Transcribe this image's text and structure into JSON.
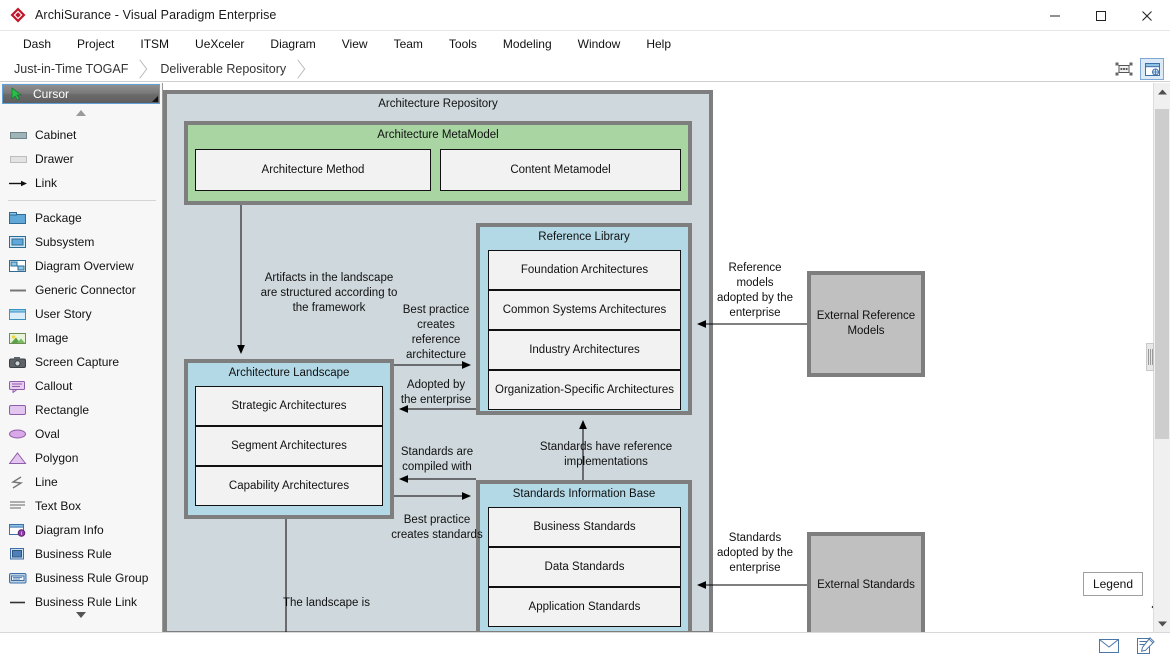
{
  "window": {
    "title": "ArchiSurance - Visual Paradigm Enterprise",
    "logo_icon": "vp-diamond-logo-icon",
    "controls": {
      "minimize": "minimize-icon",
      "maximize": "maximize-icon",
      "close": "close-icon"
    }
  },
  "menubar": {
    "items": [
      {
        "label": "Dash"
      },
      {
        "label": "Project"
      },
      {
        "label": "ITSM"
      },
      {
        "label": "UeXceler"
      },
      {
        "label": "Diagram"
      },
      {
        "label": "View"
      },
      {
        "label": "Team"
      },
      {
        "label": "Tools"
      },
      {
        "label": "Modeling"
      },
      {
        "label": "Window"
      },
      {
        "label": "Help"
      }
    ]
  },
  "breadcrumb": {
    "items": [
      {
        "label": "Just-in-Time TOGAF"
      },
      {
        "label": "Deliverable Repository"
      }
    ],
    "tools": [
      {
        "icon": "fit-to-screen-icon",
        "name": "fit-diagram-icon"
      },
      {
        "icon": "diagram-layers-icon",
        "name": "open-diagram-panel-icon"
      }
    ]
  },
  "palette": {
    "selected": {
      "label": "Cursor",
      "icon": "cursor-arrow-icon"
    },
    "scroll_up": "scroll-up-arrow-icon",
    "scroll_down": "scroll-down-arrow-icon",
    "items": [
      {
        "label": "Cabinet",
        "icon": "cabinet-icon"
      },
      {
        "label": "Drawer",
        "icon": "drawer-icon"
      },
      {
        "label": "Link",
        "icon": "link-arrow-icon"
      },
      {
        "separator": true
      },
      {
        "label": "Package",
        "icon": "package-icon"
      },
      {
        "label": "Subsystem",
        "icon": "subsystem-icon"
      },
      {
        "label": "Diagram Overview",
        "icon": "diagram-overview-icon"
      },
      {
        "label": "Generic Connector",
        "icon": "generic-connector-icon"
      },
      {
        "label": "User Story",
        "icon": "user-story-icon"
      },
      {
        "label": "Image",
        "icon": "image-icon"
      },
      {
        "label": "Screen Capture",
        "icon": "screen-capture-icon"
      },
      {
        "label": "Callout",
        "icon": "callout-icon"
      },
      {
        "label": "Rectangle",
        "icon": "rectangle-icon"
      },
      {
        "label": "Oval",
        "icon": "oval-icon"
      },
      {
        "label": "Polygon",
        "icon": "polygon-icon"
      },
      {
        "label": "Line",
        "icon": "line-icon"
      },
      {
        "label": "Text Box",
        "icon": "text-box-icon"
      },
      {
        "label": "Diagram Info",
        "icon": "diagram-info-icon"
      },
      {
        "label": "Business Rule",
        "icon": "business-rule-icon"
      },
      {
        "label": "Business Rule Group",
        "icon": "business-rule-group-icon"
      },
      {
        "label": "Business Rule Link",
        "icon": "business-rule-link-icon"
      }
    ]
  },
  "diagram": {
    "repository_title": "Architecture Repository",
    "metamodel": {
      "title": "Architecture MetaModel",
      "cells": [
        "Architecture Method",
        "Content Metamodel"
      ]
    },
    "reference_library": {
      "title": "Reference Library",
      "cells": [
        "Foundation Architectures",
        "Common Systems Architectures",
        "Industry Architectures",
        "Organization-Specific Architectures"
      ]
    },
    "architecture_landscape": {
      "title": "Architecture Landscape",
      "cells": [
        "Strategic Architectures",
        "Segment Architectures",
        "Capability Architectures"
      ]
    },
    "standards_information_base": {
      "title": "Standards Information Base",
      "cells": [
        "Business Standards",
        "Data Standards",
        "Application Standards"
      ]
    },
    "external_reference_models": {
      "title": "External Reference\nModels"
    },
    "external_standards": {
      "title": "External Standards"
    },
    "labels": {
      "artifacts_structured": "Artifacts in the landscape\nare structured according to\nthe framework",
      "best_practice_reference": "Best practice\ncreates\nreference\narchitecture",
      "adopted_by_enterprise": "Adopted by\nthe enterprise",
      "standards_compiled_with": "Standards are\ncompiled with",
      "best_practice_standards": "Best practice\ncreates standards",
      "standards_have_reference": "Standards have reference\nimplementations",
      "reference_models_adopted": "Reference\nmodels\nadopted by the\nenterprise",
      "standards_adopted": "Standards\nadopted by the\nenterprise",
      "landscape_is": "The landscape is"
    }
  },
  "canvas": {
    "legend_button": "Legend",
    "pan_icon": "pan-move-icon",
    "scrollbar": {
      "up_icon": "scroll-up-arrow-icon",
      "down_icon": "scroll-down-arrow-icon"
    },
    "splitter": "splitter-grip"
  },
  "statusbar": {
    "icons": [
      {
        "name": "mail-icon"
      },
      {
        "name": "edit-note-icon"
      }
    ]
  },
  "colors": {
    "group_border": "#7e7e7e",
    "repository_fill": "#cfd8dc",
    "metamodel_fill": "#a8d5a2",
    "library_fill": "#b3d9e6",
    "external_fill": "#c0c0c0",
    "cell_fill": "#f2f2f2",
    "accent": "#5fa0d8"
  }
}
